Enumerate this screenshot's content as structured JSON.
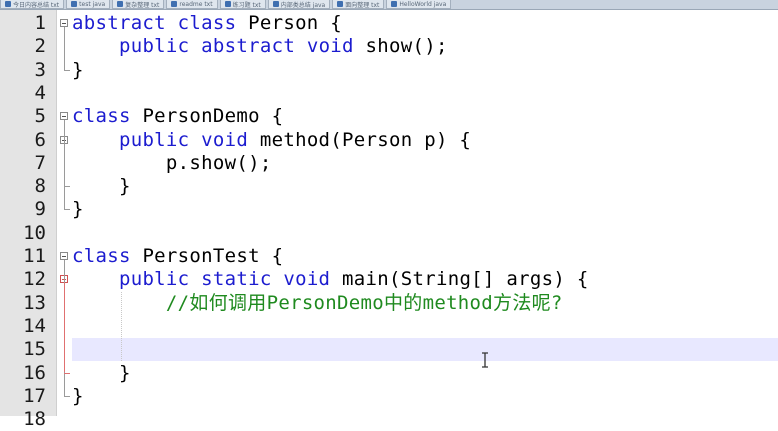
{
  "tabs": [
    {
      "label": "今日内容总结 txt"
    },
    {
      "label": "test java"
    },
    {
      "label": "复杂整理 txt"
    },
    {
      "label": "readme txt"
    },
    {
      "label": "练习题 txt"
    },
    {
      "label": "内部类总结 java"
    },
    {
      "label": "面向整理 txt"
    },
    {
      "label": "HelloWorld java"
    }
  ],
  "code_lines": [
    {
      "n": "1",
      "text": "abstract class Person {"
    },
    {
      "n": "2",
      "text": "    public abstract void show();"
    },
    {
      "n": "3",
      "text": "}"
    },
    {
      "n": "4",
      "text": ""
    },
    {
      "n": "5",
      "text": "class PersonDemo {"
    },
    {
      "n": "6",
      "text": "    public void method(Person p) {"
    },
    {
      "n": "7",
      "text": "        p.show();"
    },
    {
      "n": "8",
      "text": "    }"
    },
    {
      "n": "9",
      "text": "}"
    },
    {
      "n": "10",
      "text": ""
    },
    {
      "n": "11",
      "text": "class PersonTest {"
    },
    {
      "n": "12",
      "text": "    public static void main(String[] args) {"
    },
    {
      "n": "13",
      "text": "        //如何调用PersonDemo中的method方法呢?"
    },
    {
      "n": "14",
      "text": ""
    },
    {
      "n": "15",
      "text": ""
    },
    {
      "n": "16",
      "text": "    }"
    },
    {
      "n": "17",
      "text": "}"
    },
    {
      "n": "18",
      "text": ""
    }
  ],
  "current_line": 15,
  "colors": {
    "keyword": "#1c1ccf",
    "comment": "#1f8a1f",
    "current_line_bg": "#e8e8ff",
    "gutter_bg": "#e4e4e4"
  }
}
